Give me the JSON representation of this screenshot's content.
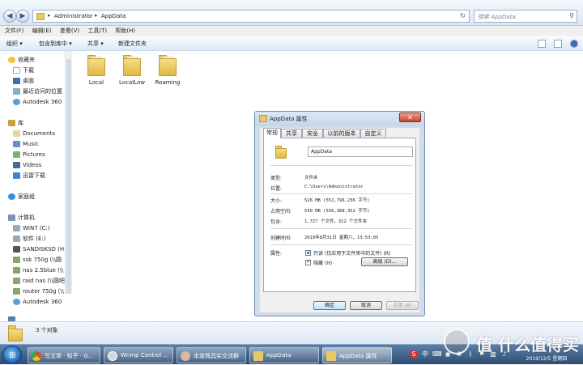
{
  "address_bar": {
    "path_segments": [
      "Administrator",
      "AppData"
    ],
    "search_placeholder": "搜索 AppData"
  },
  "menu": [
    "文件(F)",
    "编辑(E)",
    "查看(V)",
    "工具(T)",
    "帮助(H)"
  ],
  "toolbar": {
    "organize": "组织 ▾",
    "include_in_library": "包含到库中 ▾",
    "share": "共享 ▾",
    "new_folder": "新建文件夹"
  },
  "nav": {
    "favorites": "收藏夹",
    "favorites_items": [
      "下载",
      "桌面",
      "最近访问的位置",
      "Autodesk 360"
    ],
    "libraries": "库",
    "library_items": [
      "Documents",
      "Music",
      "Pictures",
      "Videos",
      "迅雷下载"
    ],
    "homegroup": "家庭组",
    "computer": "计算机",
    "computer_items": [
      "WIN7 (C:)",
      "软件 (E:)",
      "SANDISKSD (H:",
      "ssk 750g (\\\\圆",
      "nas 2.5blue (\\\\",
      "raid nas (\\\\圆吧",
      "router 750g (\\\\",
      "Autodesk 360"
    ]
  },
  "folders": [
    "Local",
    "LocalLow",
    "Roaming"
  ],
  "status": {
    "count": "3 个对象"
  },
  "dialog": {
    "title": "AppData 属性",
    "tabs": [
      "常规",
      "共享",
      "安全",
      "以前的版本",
      "自定义"
    ],
    "name": "AppData",
    "type_label": "类型:",
    "type_value": "文件夹",
    "location_label": "位置:",
    "location_value": "C:\\Users\\Administrator",
    "size_label": "大小:",
    "size_value": "526 MB (551,796,236 字节)",
    "disk_size_label": "占用空间:",
    "disk_size_value": "530 MB (556,388,352 字节)",
    "contains_label": "包含:",
    "contains_value": "1,727 个文件，312 个文件夹",
    "created_label": "创建时间:",
    "created_value": "2019年8月31日 星期六，13:53:05",
    "attributes_label": "属性:",
    "readonly_label": "只读 (仅应用于文件夹中的文件) (R)",
    "hidden_label": "隐藏 (H)",
    "advanced_button": "高级 (D)...",
    "ok_button": "确定",
    "cancel_button": "取消",
    "apply_button": "应用 (A)"
  },
  "taskbar": {
    "items": [
      "写文章 · 知乎 · G...",
      "Wnmp Control ...",
      "本渡佩具实交流群",
      "AppData",
      "AppData 属性"
    ],
    "date": "2019/12/5 星期四"
  },
  "watermark": "值 什么值得买"
}
